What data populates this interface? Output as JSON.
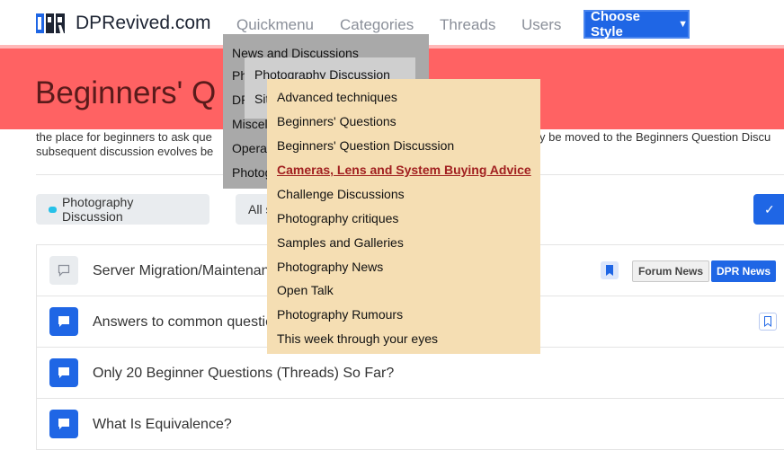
{
  "header": {
    "site_name": "DPRevived.com",
    "logo_text": "DPR",
    "nav": [
      "Quickmenu",
      "Categories",
      "Threads",
      "Users"
    ],
    "style_button": "Choose Style"
  },
  "hero": {
    "title": "Beginners' Q",
    "description_line1": "the place for beginners to ask que",
    "description_line2": "subsequent discussion evolves be",
    "description_right": "y be moved to the Beginners Question Discu",
    "color": "#ff6263"
  },
  "filters": {
    "category_chip": "Photography Discussion",
    "all_chip": "All s",
    "check_icon": "check-icon"
  },
  "threads": [
    {
      "title": "Server Migration/Maintenan",
      "read": true,
      "bookmarked": true,
      "tags": [
        "Forum News",
        "DPR News"
      ]
    },
    {
      "title": "Answers to common questic",
      "read": false,
      "bookmarked": false,
      "tags": []
    },
    {
      "title": "Only 20 Beginner Questions (Threads) So Far?",
      "read": false,
      "bookmarked": false,
      "tags": []
    },
    {
      "title": "What Is Equivalence?",
      "read": false,
      "bookmarked": false,
      "tags": []
    }
  ],
  "quickmenu": {
    "level1": [
      "News and Discussions",
      "Ph",
      "DP",
      "Miscel",
      "Opera",
      "Photog"
    ],
    "level2": [
      "Photography Discussion",
      "Sit"
    ],
    "level3": [
      "Advanced techniques",
      "Beginners' Questions",
      "Beginners' Question Discussion",
      "Cameras, Lens and System Buying Advice",
      "Challenge Discussions",
      "Photography critiques",
      "Samples and Galleries",
      "Photography News",
      "Open Talk",
      "Photography Rumours",
      "This week through your eyes"
    ],
    "active_level3": "Cameras, Lens and System Buying Advice"
  },
  "colors": {
    "accent": "#1f66e5",
    "menu_bg": "#f5deb3",
    "active_link": "#a12020"
  }
}
